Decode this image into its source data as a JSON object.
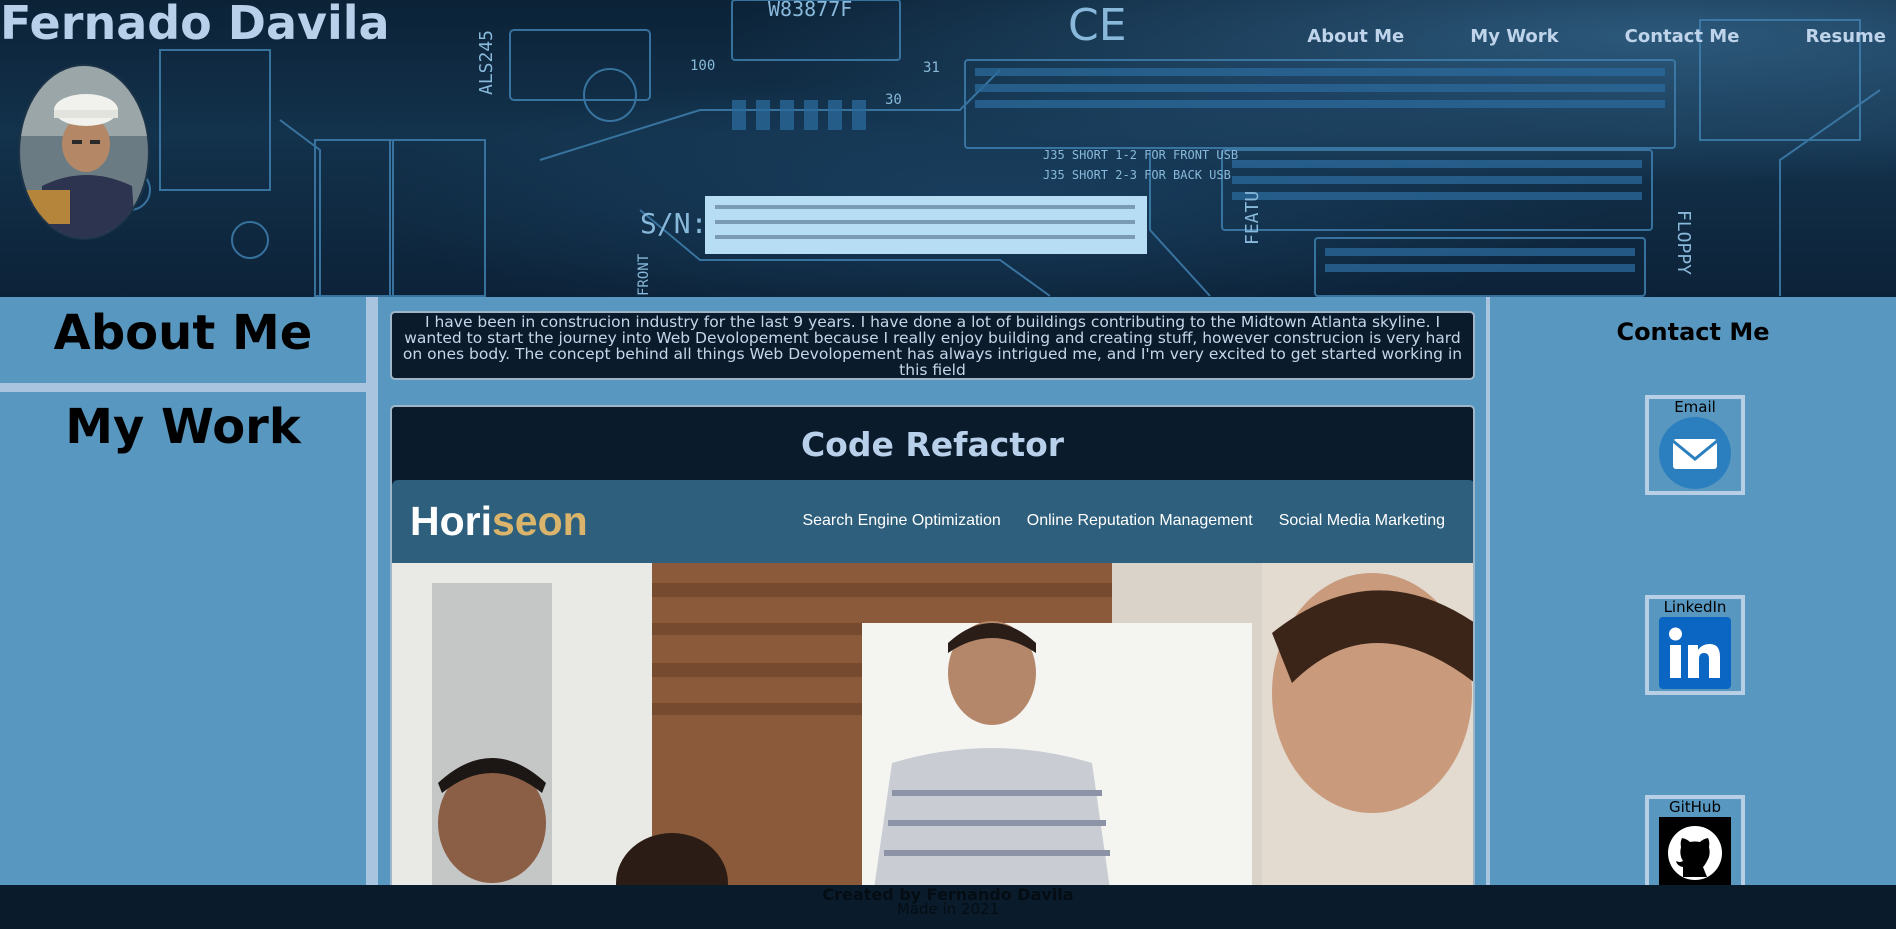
{
  "header": {
    "site_title": "Fernado Davila",
    "background_icon": "circuit-board-image",
    "avatar_icon": "profile-photo",
    "board_text": {
      "chip": "W83877F",
      "sn": "S/N:",
      "ce": "CE",
      "j35_front": "J35 SHORT 1-2 FOR FRONT USB",
      "j35_back": "J35 SHORT 2-3 FOR BACK USB",
      "chip_side": "ALS245",
      "label_100": "100",
      "label_30": "30",
      "label_31": "31",
      "floppy": "FLOPPY",
      "feature": "FEATU",
      "front": "FRONT"
    }
  },
  "nav": {
    "items": [
      {
        "label": "About Me"
      },
      {
        "label": "My Work"
      },
      {
        "label": "Contact Me"
      },
      {
        "label": "Resume"
      }
    ]
  },
  "sidebar": {
    "about_label": "About Me",
    "work_label": "My Work"
  },
  "about": {
    "text": "I have been in construcion industry for the last 9 years. I have done a lot of buildings contributing to the Midtown Atlanta skyline. I wanted to start the journey into Web Devolopement because I really enjoy building and creating stuff, however construcion is very hard on ones body. The concept behind all things Web Devolopement has always intrigued me, and I'm very excited to get started working in this field"
  },
  "project": {
    "title": "Code Refactor",
    "screenshot": {
      "logo_main": "Hori",
      "logo_highlight": "seon",
      "nav": [
        "Search Engine Optimization",
        "Online Reputation Management",
        "Social Media Marketing"
      ],
      "photo_icon": "team-meeting-photo"
    }
  },
  "contact": {
    "title": "Contact Me",
    "items": [
      {
        "label": "Email",
        "icon": "email-icon"
      },
      {
        "label": "LinkedIn",
        "icon": "linkedin-icon"
      },
      {
        "label": "GitHub",
        "icon": "github-icon"
      }
    ]
  },
  "footer": {
    "line1": "Created by Fernando Davila",
    "line2": "Made in 2021"
  },
  "colors": {
    "page_bg": "#5897bf",
    "dark_panel": "#0a1b2b",
    "accent_light": "#a9c4de",
    "title_text": "#b9d0ea"
  }
}
